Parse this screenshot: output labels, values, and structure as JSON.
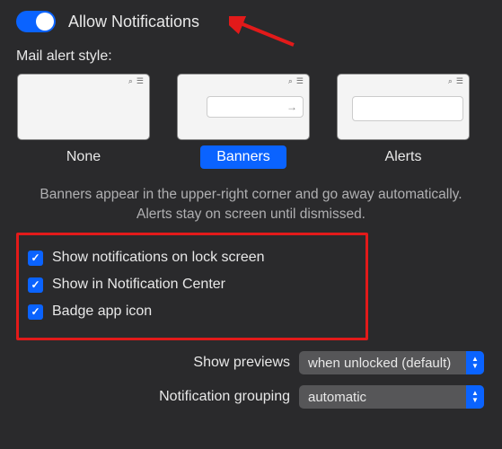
{
  "allow_notifications": {
    "label": "Allow Notifications",
    "enabled": true
  },
  "mail_alert_style_label": "Mail alert style:",
  "styles": {
    "none": "None",
    "banners": "Banners",
    "alerts": "Alerts",
    "selected": "banners"
  },
  "description": "Banners appear in the upper-right corner and go away automatically. Alerts stay on screen until dismissed.",
  "checkboxes": {
    "lock_screen": {
      "label": "Show notifications on lock screen",
      "checked": true
    },
    "notification_center": {
      "label": "Show in Notification Center",
      "checked": true
    },
    "badge": {
      "label": "Badge app icon",
      "checked": true
    }
  },
  "show_previews": {
    "label": "Show previews",
    "value": "when unlocked (default)"
  },
  "grouping": {
    "label": "Notification grouping",
    "value": "automatic"
  },
  "annotations": {
    "arrow_color": "#e21a1a",
    "highlight_box_color": "#e21a1a"
  }
}
